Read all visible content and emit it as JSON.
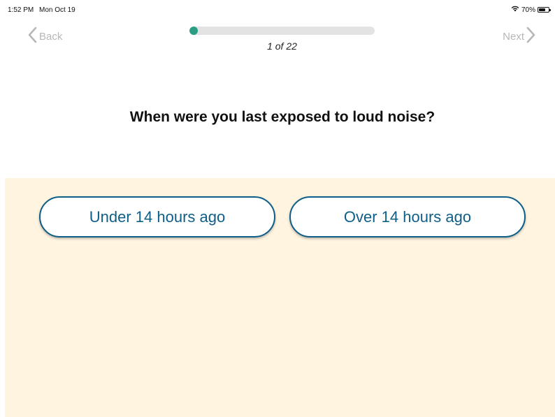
{
  "status_bar": {
    "time": "1:52 PM",
    "date": "Mon Oct 19",
    "battery_percent": "70%",
    "battery_level": 0.7,
    "wifi_icon": "wifi-icon",
    "battery_icon": "battery-icon"
  },
  "nav": {
    "back_label": "Back",
    "next_label": "Next",
    "back_icon": "chevron-left-icon",
    "next_icon": "chevron-right-icon"
  },
  "progress": {
    "label": "1 of 22",
    "current": 1,
    "total": 22,
    "fill_color": "#2a9d84"
  },
  "question": {
    "text": "When were you last exposed to loud noise?"
  },
  "answers": [
    {
      "label": "Under 14 hours ago"
    },
    {
      "label": "Over 14 hours ago"
    }
  ],
  "colors": {
    "accent": "#0f5e88",
    "panel_background": "#fff4e0",
    "nav_disabled": "#b7b7b7"
  }
}
